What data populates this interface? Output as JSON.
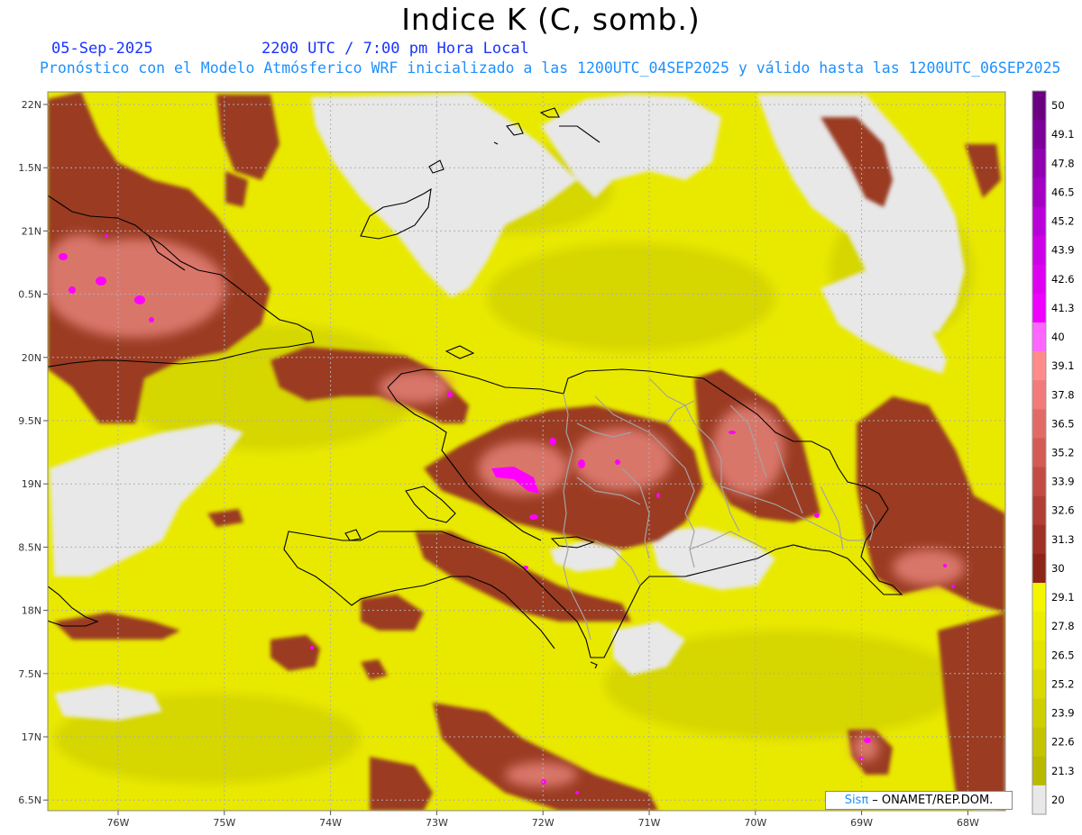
{
  "header": {
    "title": "Indice K (C, somb.)",
    "date": "05-Sep-2025",
    "time": "2200 UTC / 7:00 pm Hora Local",
    "subtitle": "Pronóstico con el Modelo Atmósferico WRF inicializado a las 1200UTC_04SEP2025 y válido hasta las  1200UTC_06SEP2025"
  },
  "map": {
    "lon_ticks": [
      "76W",
      "75W",
      "74W",
      "73W",
      "72W",
      "71W",
      "70W",
      "69W",
      "68W"
    ],
    "lat_ticks": [
      "22N",
      "1.5N",
      "21N",
      "0.5N",
      "20N",
      "9.5N",
      "19N",
      "8.5N",
      "18N",
      "7.5N",
      "17N",
      "6.5N"
    ]
  },
  "colorbar": {
    "levels": [
      "50",
      "49.1",
      "47.8",
      "46.5",
      "45.2",
      "43.9",
      "42.6",
      "41.3",
      "40",
      "39.1",
      "37.8",
      "36.5",
      "35.2",
      "33.9",
      "32.6",
      "31.3",
      "30",
      "29.1",
      "27.8",
      "26.5",
      "25.2",
      "23.9",
      "22.6",
      "21.3",
      "20"
    ],
    "colors": [
      "#6a0080",
      "#7d0099",
      "#9000b0",
      "#a400c4",
      "#b800d8",
      "#cc00e6",
      "#de00f0",
      "#f000ff",
      "#ff66ff",
      "#ff8b8b",
      "#f27a7a",
      "#e26a66",
      "#d35a55",
      "#c24c45",
      "#b03d36",
      "#9e3027",
      "#8c2418",
      "#f5f500",
      "#eded00",
      "#e4e400",
      "#dada00",
      "#cfcf00",
      "#c4c400",
      "#b9b900",
      "#e8e8e8"
    ]
  },
  "palette": {
    "background_gray": "#e8e8e8",
    "yellow": "#e8e800",
    "brown": "#9a3a22",
    "salmon": "#d9766a",
    "magenta": "#ff00ff",
    "coast": "#000000",
    "province": "#a0a0a0"
  },
  "credit": {
    "sisp": "Sisπ",
    "rest": " – ONAMET/REP.DOM."
  }
}
